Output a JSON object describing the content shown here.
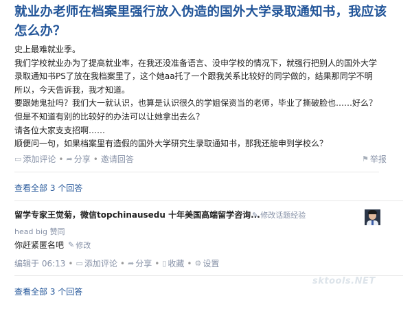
{
  "question": {
    "title": "就业办老师在档案里强行放入伪造的国外大学录取通知书，我应该怎么办？",
    "body_lines": [
      "史上最难就业季。",
      "我们学校就业办为了提高就业率，在我还没准备语言、没申学校的情况下，就强行把别人的国外大学",
      "录取通知书PS了放在我档案里了，这个她aa托了一个跟我关系比较好的同学做的，结果那同学不明",
      "所以，今天告诉我，我才知道。",
      "要跟她鬼扯吗？我们大一就认识，也算是认识很久的学姐保资当的老师，毕业了撕破脸也……好么？",
      "但是不知道有别的比较好的办法可以让她拿出去么？",
      "请各位大家支支招啊……",
      "顺便问一句，如果档案里有造假的国外大学研究生录取通知书，那我还能申到学校么？"
    ],
    "actions": {
      "comment": "添加评论",
      "share": "分享",
      "invite": "邀请回答",
      "report": "举报"
    },
    "view_all": "查看全部 3 个回答"
  },
  "answer": {
    "author": "留学专家王觉菊，微信topchinausedu 十年美国高端留学咨询...",
    "edit_experience": "修改话题经验",
    "author_sub": "head big 赞同",
    "content": "你赶紧匿名吧",
    "modify": "修改",
    "edited_time": "编辑于 06:13",
    "actions": {
      "comment": "添加评论",
      "share": "分享",
      "collect": "收藏",
      "settings": "设置"
    }
  },
  "footer": {
    "view_all": "查看全部 3 个回答",
    "watermark": "sktools.NET"
  },
  "icons": {
    "comment": "comment-icon",
    "share": "share-icon",
    "invite": "invite-icon",
    "report": "report-flag-icon",
    "pencil": "pencil-icon",
    "collect": "collect-icon",
    "settings": "gear-icon"
  },
  "colors": {
    "link_blue": "#225599",
    "meta_gray": "#8590a6",
    "divider": "#e7e7e7"
  }
}
